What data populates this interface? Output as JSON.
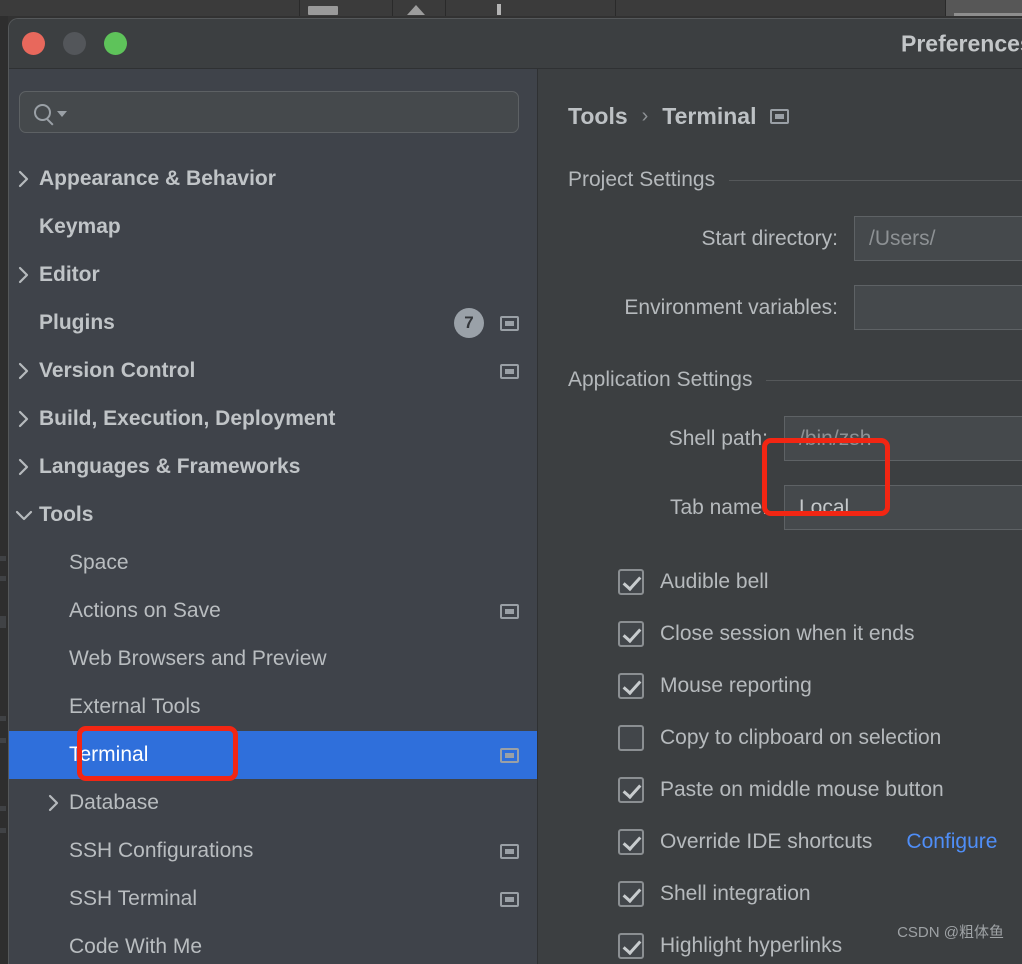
{
  "desktop": {
    "strip_icons": [
      "window-icon",
      "triangle-icon",
      "bar-icon",
      "leaf-icon",
      "active-window-icon",
      "leaf-icon",
      "bar-icon"
    ]
  },
  "window": {
    "title": "Preferences",
    "traffic_lights": [
      "close",
      "minimize",
      "maximize"
    ]
  },
  "search": {
    "value": "",
    "placeholder": ""
  },
  "sidebar": {
    "items": [
      {
        "label": "Appearance & Behavior",
        "indent": 0,
        "arrow": "right",
        "bold": true,
        "badge": null,
        "scope_icon": false,
        "selected": false
      },
      {
        "label": "Keymap",
        "indent": 0,
        "arrow": "none",
        "bold": true,
        "badge": null,
        "scope_icon": false,
        "selected": false
      },
      {
        "label": "Editor",
        "indent": 0,
        "arrow": "right",
        "bold": true,
        "badge": null,
        "scope_icon": false,
        "selected": false
      },
      {
        "label": "Plugins",
        "indent": 0,
        "arrow": "none",
        "bold": true,
        "badge": "7",
        "scope_icon": true,
        "selected": false
      },
      {
        "label": "Version Control",
        "indent": 0,
        "arrow": "right",
        "bold": true,
        "badge": null,
        "scope_icon": true,
        "selected": false
      },
      {
        "label": "Build, Execution, Deployment",
        "indent": 0,
        "arrow": "right",
        "bold": true,
        "badge": null,
        "scope_icon": false,
        "selected": false
      },
      {
        "label": "Languages & Frameworks",
        "indent": 0,
        "arrow": "right",
        "bold": true,
        "badge": null,
        "scope_icon": false,
        "selected": false
      },
      {
        "label": "Tools",
        "indent": 0,
        "arrow": "down",
        "bold": true,
        "badge": null,
        "scope_icon": false,
        "selected": false
      },
      {
        "label": "Space",
        "indent": 1,
        "arrow": "none",
        "bold": false,
        "badge": null,
        "scope_icon": false,
        "selected": false
      },
      {
        "label": "Actions on Save",
        "indent": 1,
        "arrow": "none",
        "bold": false,
        "badge": null,
        "scope_icon": true,
        "selected": false
      },
      {
        "label": "Web Browsers and Preview",
        "indent": 1,
        "arrow": "none",
        "bold": false,
        "badge": null,
        "scope_icon": false,
        "selected": false
      },
      {
        "label": "External Tools",
        "indent": 1,
        "arrow": "none",
        "bold": false,
        "badge": null,
        "scope_icon": false,
        "selected": false
      },
      {
        "label": "Terminal",
        "indent": 1,
        "arrow": "none",
        "bold": false,
        "badge": null,
        "scope_icon": true,
        "selected": true
      },
      {
        "label": "Database",
        "indent": 1,
        "arrow": "right",
        "bold": false,
        "badge": null,
        "scope_icon": false,
        "selected": false
      },
      {
        "label": "SSH Configurations",
        "indent": 1,
        "arrow": "none",
        "bold": false,
        "badge": null,
        "scope_icon": true,
        "selected": false
      },
      {
        "label": "SSH Terminal",
        "indent": 1,
        "arrow": "none",
        "bold": false,
        "badge": null,
        "scope_icon": true,
        "selected": false
      },
      {
        "label": "Code With Me",
        "indent": 1,
        "arrow": "none",
        "bold": false,
        "badge": null,
        "scope_icon": false,
        "selected": false
      }
    ]
  },
  "panel": {
    "breadcrumb": {
      "parent": "Tools",
      "separator": "›",
      "current": "Terminal"
    },
    "project_settings": {
      "title": "Project Settings",
      "fields": [
        {
          "label": "Start directory:",
          "value": "/Users/",
          "placeholder": true
        },
        {
          "label": "Environment variables:",
          "value": "",
          "placeholder": false
        }
      ]
    },
    "application_settings": {
      "title": "Application Settings",
      "fields": [
        {
          "label": "Shell path:",
          "value": "/bin/zsh",
          "placeholder": true
        },
        {
          "label": "Tab name:",
          "value": "Local",
          "placeholder": false
        }
      ],
      "checkboxes": [
        {
          "label": "Audible bell",
          "checked": true,
          "link": null
        },
        {
          "label": "Close session when it ends",
          "checked": true,
          "link": null
        },
        {
          "label": "Mouse reporting",
          "checked": true,
          "link": null
        },
        {
          "label": "Copy to clipboard on selection",
          "checked": false,
          "link": null
        },
        {
          "label": "Paste on middle mouse button",
          "checked": true,
          "link": null
        },
        {
          "label": "Override IDE shortcuts",
          "checked": true,
          "link": "Configure"
        },
        {
          "label": "Shell integration",
          "checked": true,
          "link": null
        },
        {
          "label": "Highlight hyperlinks",
          "checked": true,
          "link": null
        }
      ]
    },
    "watermark": "CSDN @粗体鱼"
  },
  "annotations": {
    "terminal_box_color": "#f22613",
    "shell_path_box_color": "#f22613"
  }
}
